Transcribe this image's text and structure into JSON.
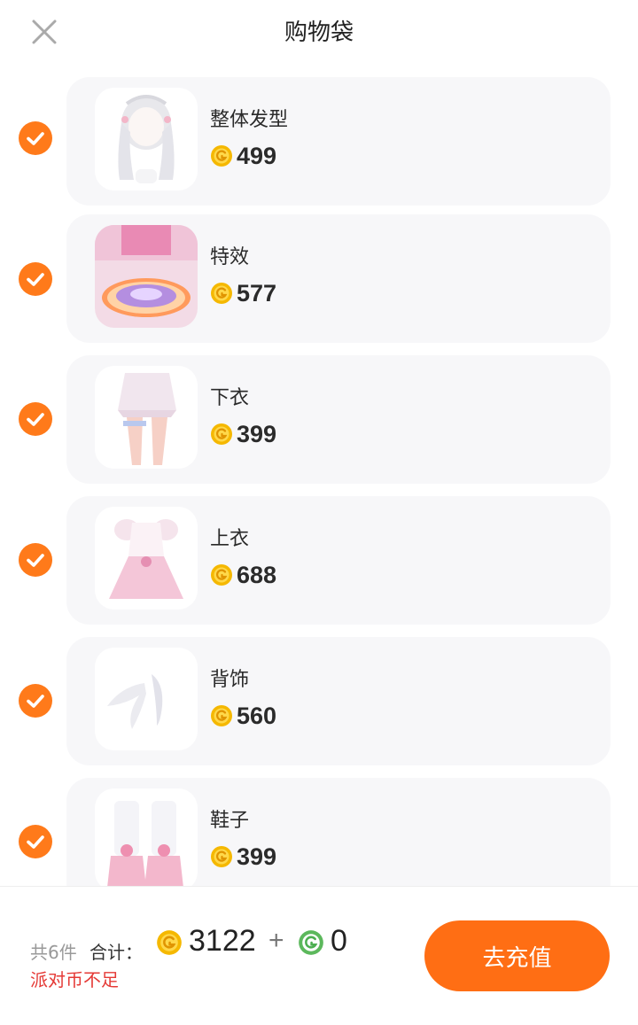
{
  "header": {
    "title": "购物袋",
    "close_icon": "close-icon"
  },
  "colors": {
    "accent": "#ff7a1a",
    "button": "#ff6e14",
    "coin": "#f5b800",
    "coin_green": "#4caf50",
    "warning": "#e53935"
  },
  "items": [
    {
      "name": "整体发型",
      "price": "499",
      "checked": true
    },
    {
      "name": "特效",
      "price": "577",
      "checked": true
    },
    {
      "name": "下衣",
      "price": "399",
      "checked": true
    },
    {
      "name": "上衣",
      "price": "688",
      "checked": true
    },
    {
      "name": "背饰",
      "price": "560",
      "checked": true
    },
    {
      "name": "鞋子",
      "price": "399",
      "checked": true
    }
  ],
  "footer": {
    "count": "共6件",
    "total_label": "合计：",
    "total_value": "3122",
    "plus": "+",
    "green_value": "0",
    "warning": "派对币不足",
    "button_label": "去充值"
  }
}
